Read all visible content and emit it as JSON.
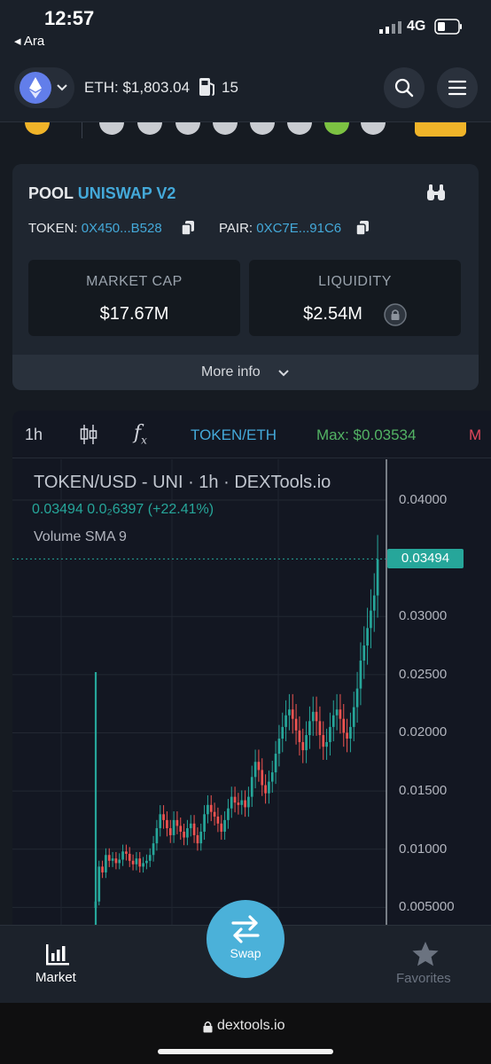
{
  "status_bar": {
    "time": "12:57",
    "back_app": "◂ Ara",
    "network": "4G"
  },
  "header": {
    "chain_icon": "ethereum-icon",
    "eth_price": "ETH: $1,803.04",
    "gas_icon": "gas-pump-icon",
    "gas_value": "15",
    "search_icon": "search-icon",
    "menu_icon": "hamburger-menu-icon"
  },
  "pool": {
    "label": "POOL",
    "name": "UNISWAP V2",
    "token_label": "TOKEN:",
    "token_value": "0X450...B528",
    "pair_label": "PAIR:",
    "pair_value": "0XC7E...91C6",
    "market_cap_label": "MARKET CAP",
    "market_cap_value": "$17.67M",
    "liquidity_label": "LIQUIDITY",
    "liquidity_value": "$2.54M",
    "more_info": "More info"
  },
  "chart_toolbar": {
    "interval": "1h",
    "fx": "f",
    "pair": "TOKEN/ETH",
    "max": "Max: $0.03534",
    "min_cut": "M"
  },
  "chart_data": {
    "type": "candlestick",
    "title": "TOKEN/USD - UNI · 1h · DEXTools.io",
    "legend_price": "0.03494  0.0₂6397 (+22.41%)",
    "legend_volume": "Volume SMA 9",
    "last_price_label": "0.03494",
    "last_price": 0.03494,
    "y_ticks": [
      "0.04000",
      "0.03000",
      "0.02500",
      "0.02000",
      "0.01500",
      "0.01000",
      "0.005000"
    ],
    "ylim": [
      0.0035,
      0.0435
    ],
    "colors": {
      "up": "#26a69a",
      "down": "#ef5350"
    },
    "close": [
      0.0055,
      0.0085,
      0.008,
      0.0095,
      0.009,
      0.0092,
      0.0088,
      0.0091,
      0.0098,
      0.0096,
      0.009,
      0.0087,
      0.0092,
      0.0085,
      0.0088,
      0.009,
      0.0095,
      0.0105,
      0.0118,
      0.013,
      0.0125,
      0.0118,
      0.0112,
      0.0125,
      0.012,
      0.0115,
      0.011,
      0.0118,
      0.0122,
      0.0112,
      0.0105,
      0.0115,
      0.013,
      0.0138,
      0.0132,
      0.0128,
      0.0122,
      0.0115,
      0.0125,
      0.0135,
      0.0145,
      0.014,
      0.0138,
      0.0142,
      0.0136,
      0.0145,
      0.0162,
      0.0175,
      0.0168,
      0.0155,
      0.0148,
      0.0158,
      0.0166,
      0.0182,
      0.0195,
      0.0205,
      0.0215,
      0.022,
      0.0212,
      0.0202,
      0.0192,
      0.0185,
      0.0198,
      0.021,
      0.0218,
      0.021,
      0.0198,
      0.0188,
      0.0192,
      0.0205,
      0.0215,
      0.022,
      0.0212,
      0.02,
      0.0195,
      0.0205,
      0.0222,
      0.0238,
      0.0262,
      0.0275,
      0.029,
      0.0305,
      0.0318,
      0.0349
    ],
    "volume_spike_index": 0
  },
  "bottom_nav": {
    "market_label": "Market",
    "market_icon": "bar-chart-icon",
    "swap_label": "Swap",
    "swap_icon": "swap-arrows-icon",
    "favorites_label": "Favorites",
    "favorites_icon": "star-icon"
  },
  "browser": {
    "url": "dextools.io",
    "lock_icon": "lock-icon"
  }
}
